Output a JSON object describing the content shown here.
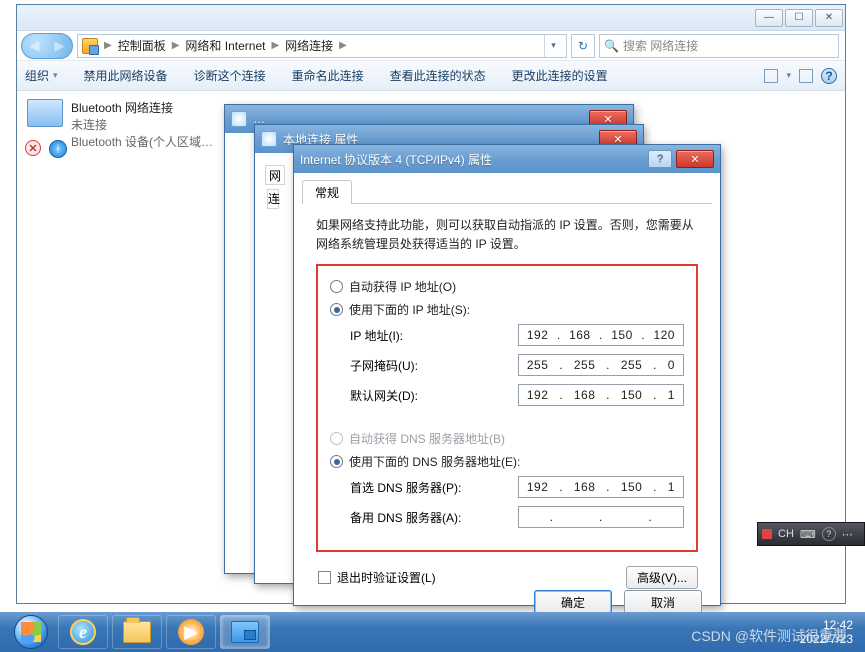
{
  "window": {
    "crumbs": [
      "控制面板",
      "网络和 Internet",
      "网络连接"
    ],
    "search_placeholder": "搜索 网络连接"
  },
  "toolbar": {
    "org": "组织",
    "disable": "禁用此网络设备",
    "diag": "诊断这个连接",
    "rename": "重命名此连接",
    "status": "查看此连接的状态",
    "change": "更改此连接的设置"
  },
  "bt": {
    "title": "Bluetooth 网络连接",
    "status": "未连接",
    "device": "Bluetooth 设备(个人区域…"
  },
  "dlg2": {
    "title": "本地连接 属性"
  },
  "dlg3": {
    "title": "Internet 协议版本 4 (TCP/IPv4) 属性",
    "tab": "常规",
    "desc": "如果网络支持此功能，则可以获取自动指派的 IP 设置。否则，您需要从网络系统管理员处获得适当的 IP 设置。",
    "auto_ip": "自动获得 IP 地址(O)",
    "manual_ip": "使用下面的 IP 地址(S):",
    "ip_label": "IP 地址(I):",
    "mask_label": "子网掩码(U):",
    "gw_label": "默认网关(D):",
    "auto_dns": "自动获得 DNS 服务器地址(B)",
    "manual_dns": "使用下面的 DNS 服务器地址(E):",
    "dns1_label": "首选 DNS 服务器(P):",
    "dns2_label": "备用 DNS 服务器(A):",
    "ip": [
      "192",
      "168",
      "150",
      "120"
    ],
    "mask": [
      "255",
      "255",
      "255",
      "0"
    ],
    "gw": [
      "192",
      "168",
      "150",
      "1"
    ],
    "dns1": [
      "192",
      "168",
      "150",
      "1"
    ],
    "dns2": [
      "",
      "",
      "",
      ""
    ],
    "exit_validate": "退出时验证设置(L)",
    "advanced": "高级(V)...",
    "ok": "确定",
    "cancel": "取消"
  },
  "ime": {
    "label": "CH"
  },
  "watermark": "CSDN @软件测试很重要",
  "clock": {
    "time": "12:42",
    "date": "2022/7/23"
  }
}
